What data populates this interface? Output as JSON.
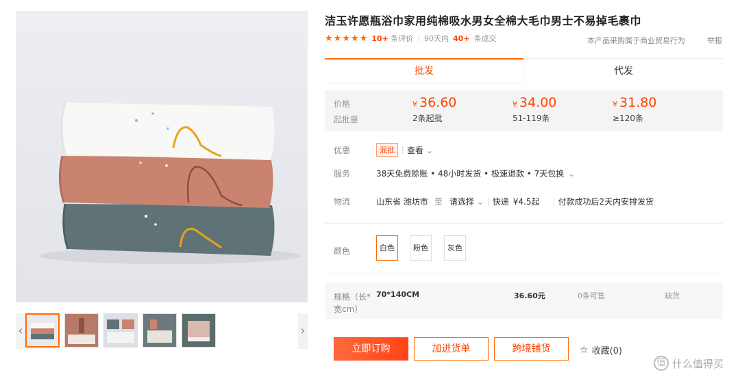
{
  "product": {
    "title": "洁玉许愿瓶浴巾家用纯棉吸水男女全棉大毛巾男士不易掉毛裹巾",
    "review_count": "10+",
    "review_label": "条评价",
    "period": "90天内",
    "deal_count": "40+",
    "deal_label": "条成交",
    "notice": "本产品采购属于商业贸易行为",
    "report": "举报"
  },
  "gallery": {
    "prev": "‹",
    "next": "›"
  },
  "tabs": {
    "wholesale": "批发",
    "dropship": "代发"
  },
  "pricing": {
    "price_label": "价格",
    "moq_label": "起批量",
    "currency": "¥",
    "tiers": [
      {
        "price": "36.60",
        "qty": "2条起批"
      },
      {
        "price": "34.00",
        "qty": "51-119条"
      },
      {
        "price": "31.80",
        "qty": "≥120条"
      }
    ]
  },
  "promo": {
    "label": "优惠",
    "badge": "混批",
    "view": "查看"
  },
  "service": {
    "label": "服务",
    "value": "38天免费赊账 • 48小时发货 • 极速退款 • 7天包换"
  },
  "logistics": {
    "label": "物流",
    "origin": "山东省 潍坊市",
    "to": "至",
    "dest": "请选择",
    "express": "快递",
    "fee": "¥4.5起",
    "dispatch": "付款成功后2天内安排发货"
  },
  "color": {
    "label": "颜色",
    "options": [
      "白色",
      "粉色",
      "灰色"
    ]
  },
  "spec": {
    "label": "规格（长*宽cm）",
    "name": "70*140CM",
    "price": "36.60元",
    "stock": "0条可售",
    "status": "缺货"
  },
  "actions": {
    "buy": "立即订购",
    "add": "加进货单",
    "cross": "跨境铺货",
    "fav": "收藏(0)"
  },
  "watermark": {
    "text": "什么值得买",
    "glyph": "值"
  },
  "colors": {
    "accent": "#ff6a00",
    "price": "#ff4400"
  }
}
